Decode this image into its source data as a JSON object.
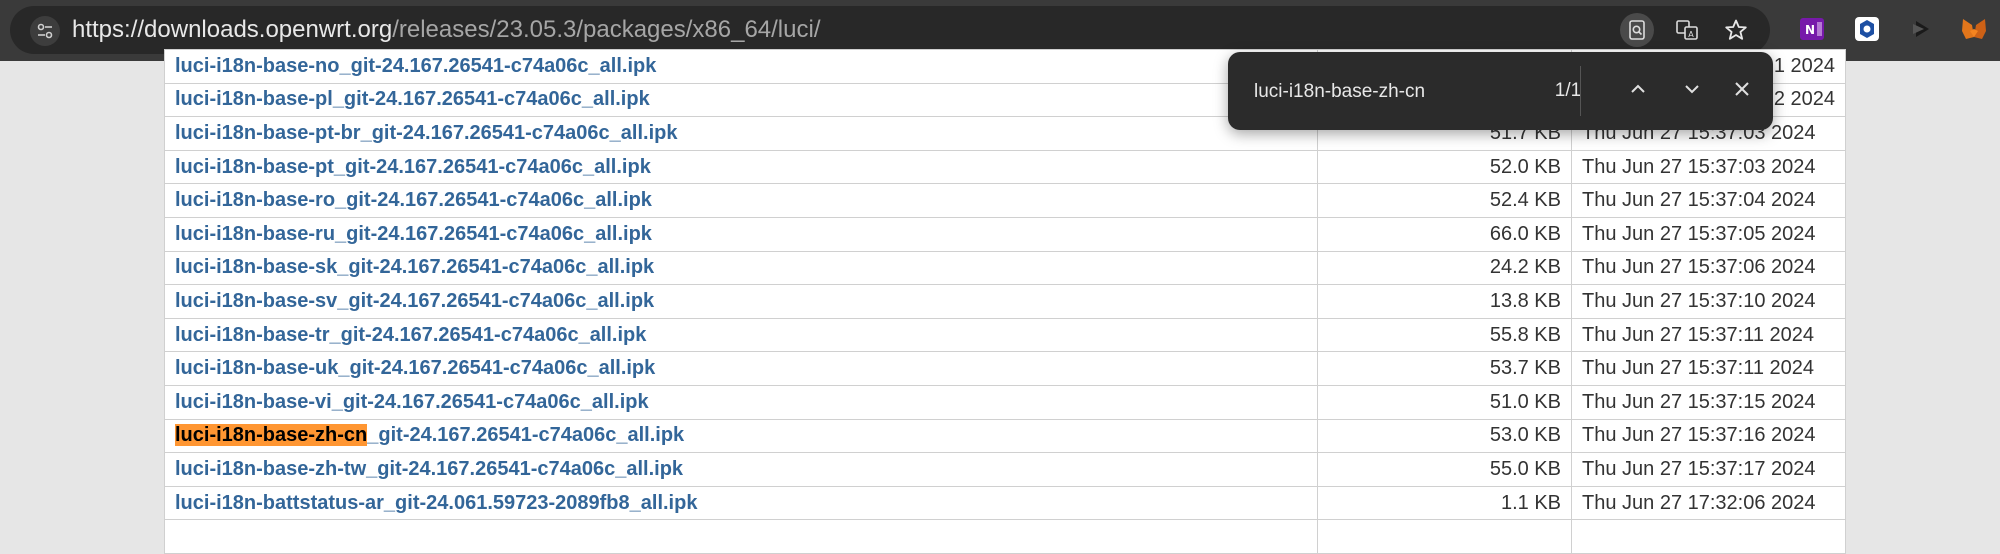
{
  "browser": {
    "url_host": "https://downloads.openwrt.org",
    "url_path": "/releases/23.05.3/packages/x86_64/luci/",
    "extensions": [
      {
        "icon": "onenote-extension-icon",
        "color": "#7719aa"
      },
      {
        "icon": "hexagon-extension-icon",
        "color": "#1d4fa3"
      },
      {
        "icon": "media-extension-icon",
        "color": "#555555"
      },
      {
        "icon": "metamask-fox-icon",
        "color": "#e2761b"
      }
    ]
  },
  "find": {
    "query": "luci-i18n-base-zh-cn",
    "count": "1/1"
  },
  "listing": {
    "rows": [
      {
        "name": "luci-i18n-base-no_git-24.167.26541-c74a06c_all.ipk",
        "size": "",
        "date": "1 2024"
      },
      {
        "name": "luci-i18n-base-pl_git-24.167.26541-c74a06c_all.ipk",
        "size": "",
        "date": "2 2024"
      },
      {
        "name": "luci-i18n-base-pt-br_git-24.167.26541-c74a06c_all.ipk",
        "size": "51.7 KB",
        "date": "Thu Jun 27 15:37:03 2024"
      },
      {
        "name": "luci-i18n-base-pt_git-24.167.26541-c74a06c_all.ipk",
        "size": "52.0 KB",
        "date": "Thu Jun 27 15:37:03 2024"
      },
      {
        "name": "luci-i18n-base-ro_git-24.167.26541-c74a06c_all.ipk",
        "size": "52.4 KB",
        "date": "Thu Jun 27 15:37:04 2024"
      },
      {
        "name": "luci-i18n-base-ru_git-24.167.26541-c74a06c_all.ipk",
        "size": "66.0 KB",
        "date": "Thu Jun 27 15:37:05 2024"
      },
      {
        "name": "luci-i18n-base-sk_git-24.167.26541-c74a06c_all.ipk",
        "size": "24.2 KB",
        "date": "Thu Jun 27 15:37:06 2024"
      },
      {
        "name": "luci-i18n-base-sv_git-24.167.26541-c74a06c_all.ipk",
        "size": "13.8 KB",
        "date": "Thu Jun 27 15:37:10 2024"
      },
      {
        "name": "luci-i18n-base-tr_git-24.167.26541-c74a06c_all.ipk",
        "size": "55.8 KB",
        "date": "Thu Jun 27 15:37:11 2024"
      },
      {
        "name": "luci-i18n-base-uk_git-24.167.26541-c74a06c_all.ipk",
        "size": "53.7 KB",
        "date": "Thu Jun 27 15:37:11 2024"
      },
      {
        "name": "luci-i18n-base-vi_git-24.167.26541-c74a06c_all.ipk",
        "size": "51.0 KB",
        "date": "Thu Jun 27 15:37:15 2024"
      },
      {
        "name": "luci-i18n-base-zh-cn_git-24.167.26541-c74a06c_all.ipk",
        "size": "53.0 KB",
        "date": "Thu Jun 27 15:37:16 2024",
        "highlight": "luci-i18n-base-zh-cn"
      },
      {
        "name": "luci-i18n-base-zh-tw_git-24.167.26541-c74a06c_all.ipk",
        "size": "55.0 KB",
        "date": "Thu Jun 27 15:37:17 2024"
      },
      {
        "name": "luci-i18n-battstatus-ar_git-24.061.59723-2089fb8_all.ipk",
        "size": "1.1 KB",
        "date": "Thu Jun 27 17:32:06 2024"
      },
      {
        "name": "",
        "size": "",
        "date": ""
      }
    ]
  }
}
